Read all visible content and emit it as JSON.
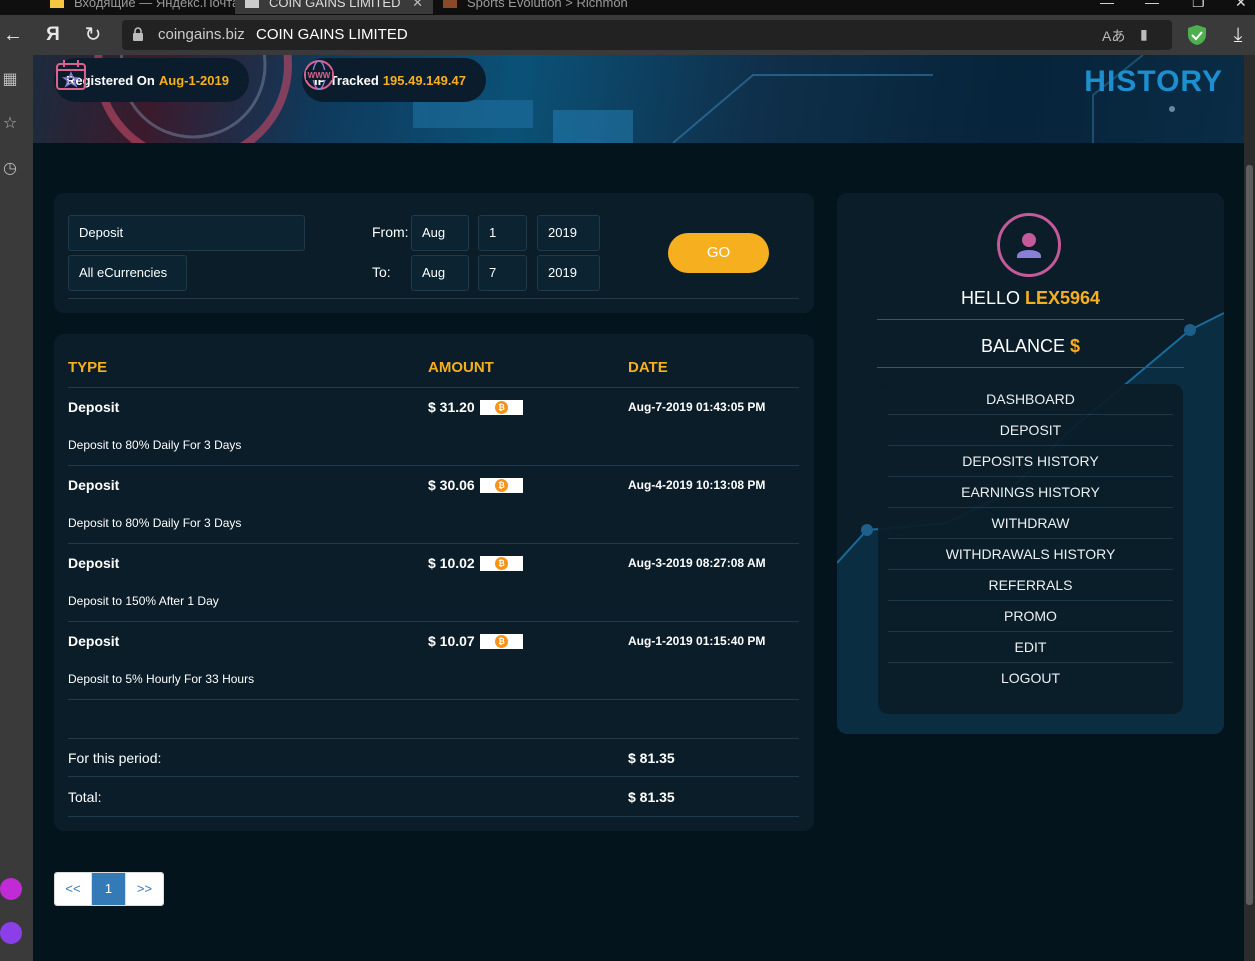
{
  "browser": {
    "tabs": [
      {
        "label": "Входящие — Яндекс.Почта"
      },
      {
        "label": "COIN GAINS LIMITED"
      },
      {
        "label": "Sports Evolution > Richmon"
      }
    ],
    "url_domain": "coingains.biz",
    "url_title": "COIN GAINS LIMITED",
    "yandex_glyph": "Я"
  },
  "banner": {
    "registered_label": "Registered On",
    "registered_date": "Aug-1-2019",
    "ip_label": "IP Tracked",
    "ip_value": "195.49.149.47",
    "page_title": "HISTORY"
  },
  "filter": {
    "type_value": "Deposit",
    "currency_value": "All eCurrencies",
    "from_label": "From:",
    "to_label": "To:",
    "from_month": "Aug",
    "from_day": "1",
    "from_year": "2019",
    "to_month": "Aug",
    "to_day": "7",
    "to_year": "2019",
    "go_label": "GO"
  },
  "table": {
    "headers": {
      "type": "TYPE",
      "amount": "AMOUNT",
      "date": "DATE"
    },
    "rows": [
      {
        "type": "Deposit",
        "amount": "$ 31.20",
        "date": "Aug-7-2019 01:43:05 PM",
        "desc": "Deposit to 80% Daily For 3 Days"
      },
      {
        "type": "Deposit",
        "amount": "$ 30.06",
        "date": "Aug-4-2019 10:13:08 PM",
        "desc": "Deposit to 80% Daily For 3 Days"
      },
      {
        "type": "Deposit",
        "amount": "$ 10.02",
        "date": "Aug-3-2019 08:27:08 AM",
        "desc": "Deposit to 150% After 1 Day"
      },
      {
        "type": "Deposit",
        "amount": "$ 10.07",
        "date": "Aug-1-2019 01:15:40 PM",
        "desc": "Deposit to 5% Hourly For 33 Hours"
      }
    ],
    "period_label": "For this period:",
    "period_value": "$ 81.35",
    "total_label": "Total:",
    "total_value": "$ 81.35"
  },
  "pager": {
    "prev": "<<",
    "current": "1",
    "next": ">>"
  },
  "account": {
    "hello": "HELLO",
    "username": "LEX5964",
    "balance_label": "BALANCE",
    "balance_symbol": "$",
    "menu": [
      "DASHBOARD",
      "DEPOSIT",
      "DEPOSITS HISTORY",
      "EARNINGS HISTORY",
      "WITHDRAW",
      "WITHDRAWALS HISTORY",
      "REFERRALS",
      "PROMO",
      "EDIT",
      "LOGOUT"
    ]
  },
  "colors": {
    "accent": "#f6b01f",
    "title_blue": "#1d8fd1",
    "panel": "#0a1d29",
    "background": "#03141c"
  }
}
